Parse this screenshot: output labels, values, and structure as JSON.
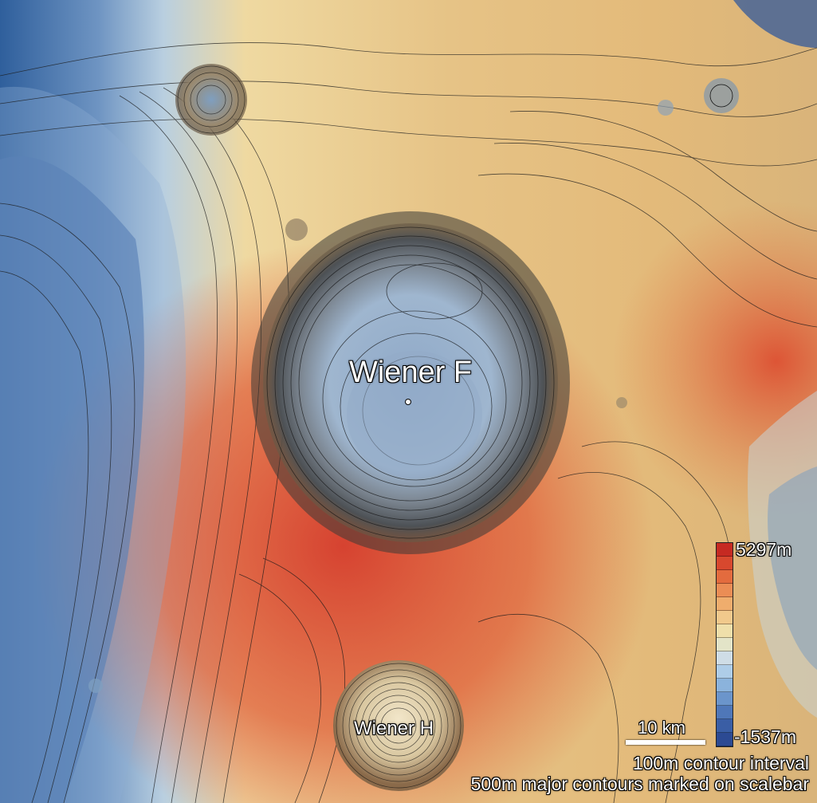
{
  "map": {
    "features": [
      {
        "id": "crater-f",
        "label": "Wiener F"
      },
      {
        "id": "crater-h",
        "label": "Wiener H"
      }
    ],
    "scalebar": {
      "label": "10 km"
    },
    "legend": {
      "max_label": "5297m",
      "min_label": "-1537m",
      "colors": [
        "#c62a22",
        "#d8482e",
        "#e36b3e",
        "#eb8d55",
        "#efad6d",
        "#f1c98c",
        "#efdfaa",
        "#e3e4c8",
        "#cfdde6",
        "#aecde8",
        "#8bb3dc",
        "#6b95cb",
        "#4f77b8",
        "#3a5ea5",
        "#2c4a93"
      ]
    },
    "notes": [
      "100m contour interval",
      "500m major contours marked on scalebar"
    ]
  }
}
